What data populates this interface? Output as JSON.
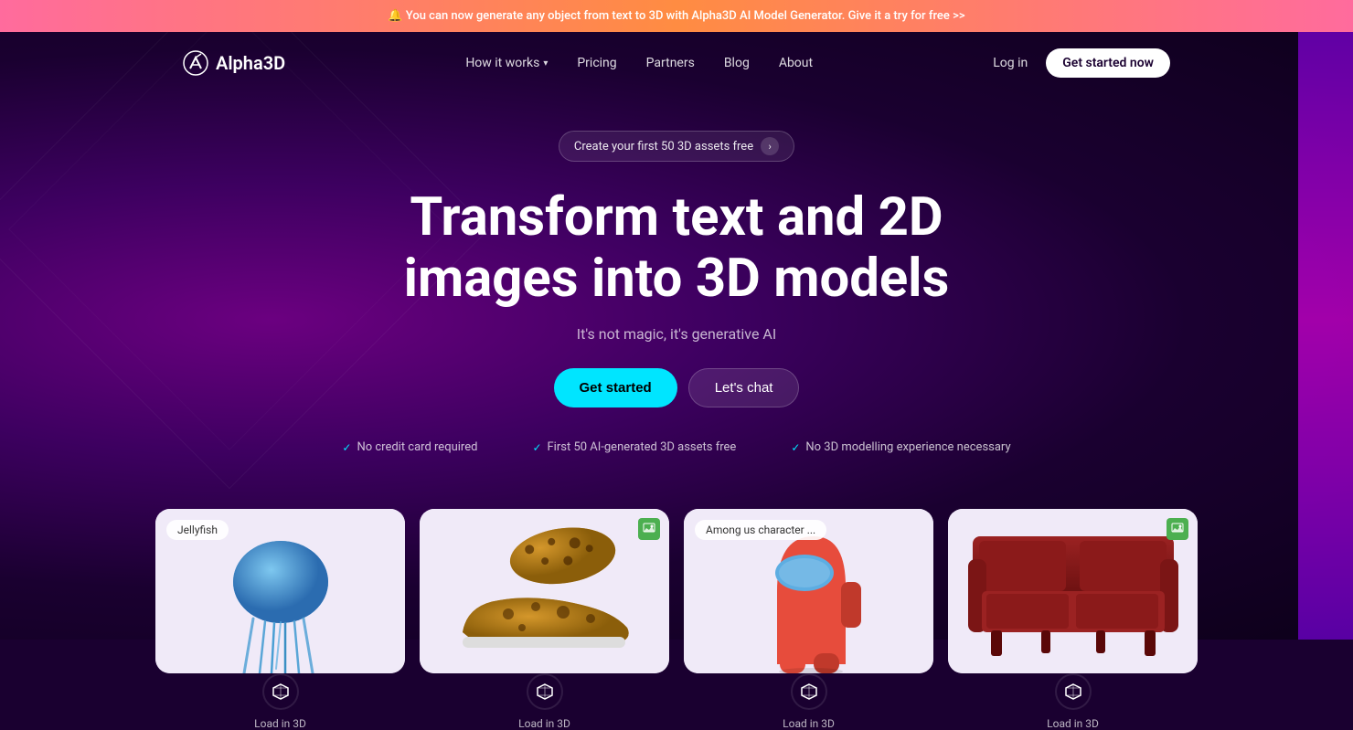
{
  "announcement": {
    "emoji": "🔔",
    "text": "You can now generate any object from text to 3D with Alpha3D AI Model Generator. Give it a try for free >>"
  },
  "nav": {
    "logo": "Alpha3D",
    "links": [
      {
        "label": "How it works",
        "hasDropdown": true
      },
      {
        "label": "Pricing",
        "hasDropdown": false
      },
      {
        "label": "Partners",
        "hasDropdown": false
      },
      {
        "label": "Blog",
        "hasDropdown": false
      },
      {
        "label": "About",
        "hasDropdown": false
      }
    ],
    "login": "Log in",
    "cta": "Get started now"
  },
  "hero": {
    "badge_text": "Create your first 50 3D assets free",
    "title": "Transform text and 2D images into 3D models",
    "subtitle": "It's not magic, it's generative AI",
    "btn_get_started": "Get started",
    "btn_lets_chat": "Let's chat",
    "features": [
      "No credit card required",
      "First 50 AI-generated 3D assets free",
      "No 3D modelling experience necessary"
    ]
  },
  "cards": [
    {
      "id": "jellyfish",
      "label": "Jellyfish",
      "has_image_icon": false,
      "load_label": "Load in 3D"
    },
    {
      "id": "sneaker",
      "label": null,
      "has_image_icon": true,
      "load_label": "Load in 3D"
    },
    {
      "id": "among-us",
      "label": "Among us character ...",
      "has_image_icon": false,
      "load_label": "Load in 3D"
    },
    {
      "id": "couch",
      "label": null,
      "has_image_icon": true,
      "load_label": "Load in 3D"
    }
  ],
  "colors": {
    "accent_cyan": "#00e5ff",
    "bg_dark": "#1a0030",
    "announcement_gradient_start": "#ff6b9d",
    "announcement_gradient_end": "#ff8c42"
  }
}
